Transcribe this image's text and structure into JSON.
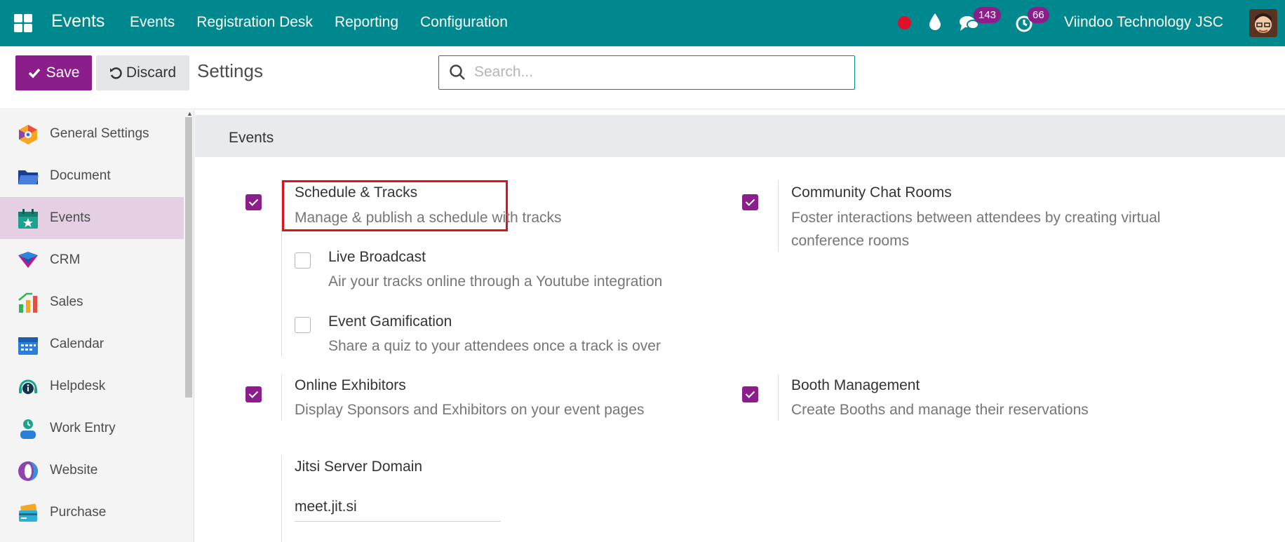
{
  "navbar": {
    "app_name": "Events",
    "menu": [
      "Events",
      "Registration Desk",
      "Reporting",
      "Configuration"
    ],
    "chat_count": "143",
    "activity_count": "66",
    "company": "Viindoo Technology JSC",
    "colors": {
      "bar": "#00888f",
      "badge": "#8b1e8b",
      "record": "#e0102a"
    }
  },
  "control_panel": {
    "save_label": "Save",
    "discard_label": "Discard",
    "title": "Settings",
    "search_placeholder": "Search..."
  },
  "sidebar": {
    "items": [
      {
        "label": "General Settings",
        "icon": "general-settings-icon"
      },
      {
        "label": "Document",
        "icon": "folder-icon"
      },
      {
        "label": "Events",
        "icon": "calendar-star-icon",
        "active": true
      },
      {
        "label": "CRM",
        "icon": "crm-icon"
      },
      {
        "label": "Sales",
        "icon": "sales-chart-icon"
      },
      {
        "label": "Calendar",
        "icon": "calendar-icon"
      },
      {
        "label": "Helpdesk",
        "icon": "headset-icon"
      },
      {
        "label": "Work Entry",
        "icon": "work-entry-icon"
      },
      {
        "label": "Website",
        "icon": "website-icon"
      },
      {
        "label": "Purchase",
        "icon": "credit-card-icon"
      }
    ]
  },
  "section": {
    "title": "Events",
    "options": {
      "schedule": {
        "title": "Schedule & Tracks",
        "desc": "Manage & publish a schedule with tracks",
        "checked": true
      },
      "live": {
        "title": "Live Broadcast",
        "desc": "Air your tracks online through a Youtube integration",
        "checked": false
      },
      "gamification": {
        "title": "Event Gamification",
        "desc": "Share a quiz to your attendees once a track is over",
        "checked": false
      },
      "chat_rooms": {
        "title": "Community Chat Rooms",
        "desc": "Foster interactions between attendees by creating virtual conference rooms",
        "checked": true
      },
      "exhibitors": {
        "title": "Online Exhibitors",
        "desc": "Display Sponsors and Exhibitors on your event pages",
        "checked": true
      },
      "booth": {
        "title": "Booth Management",
        "desc": "Create Booths and manage their reservations",
        "checked": true
      }
    },
    "jitsi": {
      "label": "Jitsi Server Domain",
      "value": "meet.jit.si"
    }
  }
}
